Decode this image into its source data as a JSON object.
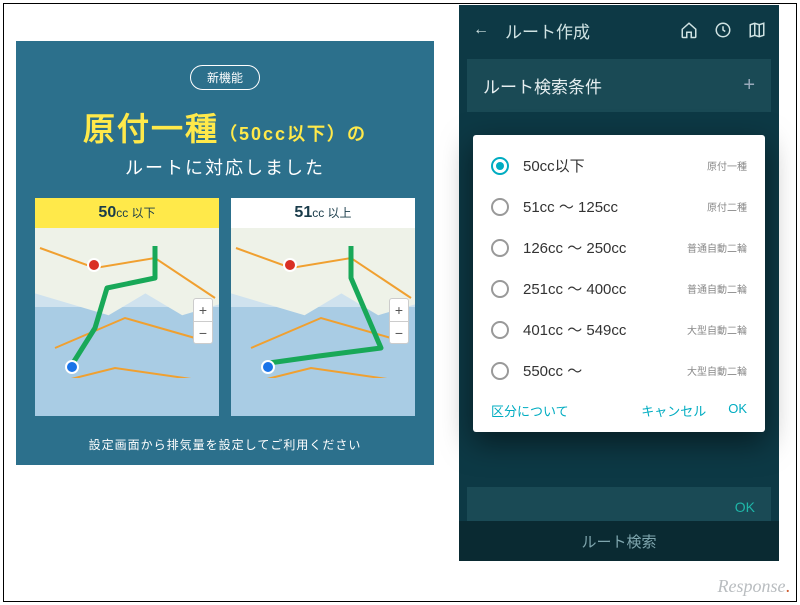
{
  "promo": {
    "badge": "新機能",
    "headline_main": "原付一種",
    "headline_sub": "（50cc以下）",
    "headline_tail": "の",
    "subhead": "ルートに対応しました",
    "card50_num": "50",
    "card50_unit": "cc 以下",
    "card51_num": "51",
    "card51_unit": "cc 以上",
    "footnote": "設定画面から排気量を設定してご利用ください"
  },
  "app": {
    "back_icon": "←",
    "title": "ルート作成",
    "section": "ルート検索条件",
    "bottom_ok": "OK",
    "search": "ルート検索"
  },
  "dialog": {
    "options": [
      {
        "label": "50cc以下",
        "category": "原付一種",
        "selected": true
      },
      {
        "label": "51cc ～ 125cc",
        "category": "原付二種",
        "selected": false
      },
      {
        "label": "126cc ～ 250cc",
        "category": "普通自動二輪",
        "selected": false
      },
      {
        "label": "251cc ～ 400cc",
        "category": "普通自動二輪",
        "selected": false
      },
      {
        "label": "401cc ～ 549cc",
        "category": "大型自動二輪",
        "selected": false
      },
      {
        "label": "550cc ～",
        "category": "大型自動二輪",
        "selected": false
      }
    ],
    "about": "区分について",
    "cancel": "キャンセル",
    "ok": "OK"
  },
  "watermark": {
    "text": "Response",
    "dot": "."
  }
}
